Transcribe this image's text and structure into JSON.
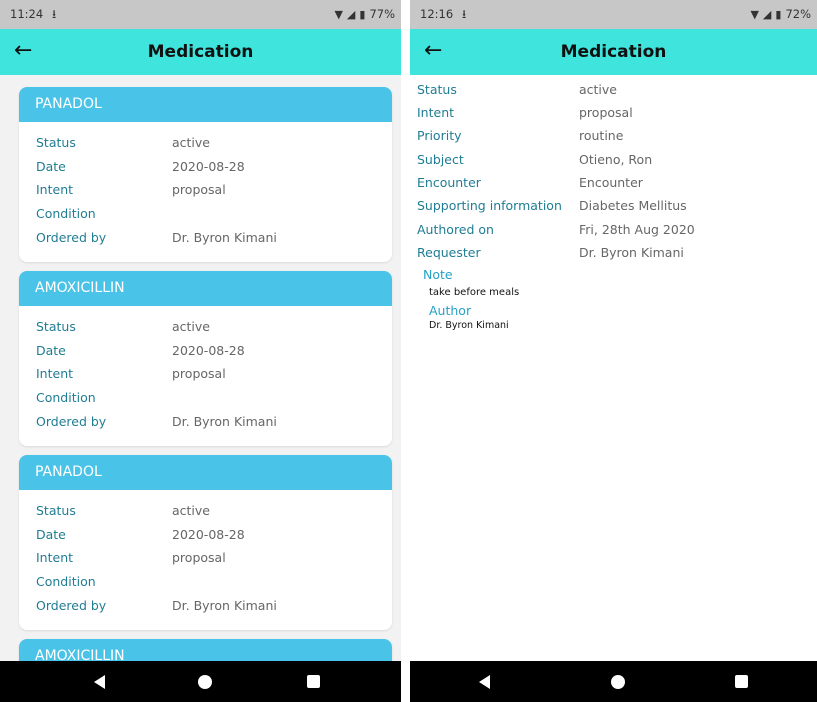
{
  "left_screen": {
    "status_bar": {
      "time": "11:24",
      "battery": "77%"
    },
    "app_bar": {
      "title": "Medication"
    },
    "labels": {
      "status": "Status",
      "date": "Date",
      "intent": "Intent",
      "condition": "Condition",
      "ordered_by": "Ordered by"
    },
    "cards": [
      {
        "name": "PANADOL",
        "status": "active",
        "date": "2020-08-28",
        "intent": "proposal",
        "condition": "",
        "ordered_by": "Dr. Byron Kimani"
      },
      {
        "name": "AMOXICILLIN",
        "status": "active",
        "date": "2020-08-28",
        "intent": "proposal",
        "condition": "",
        "ordered_by": "Dr. Byron Kimani"
      },
      {
        "name": "PANADOL",
        "status": "active",
        "date": "2020-08-28",
        "intent": "proposal",
        "condition": "",
        "ordered_by": "Dr. Byron Kimani"
      },
      {
        "name": "AMOXICILLIN"
      }
    ]
  },
  "right_screen": {
    "status_bar": {
      "time": "12:16",
      "battery": "72%"
    },
    "app_bar": {
      "title": "Medication"
    },
    "details": [
      {
        "label": "Status",
        "value": "active"
      },
      {
        "label": "Intent",
        "value": "proposal"
      },
      {
        "label": "Priority",
        "value": "routine"
      },
      {
        "label": "Subject",
        "value": "Otieno, Ron"
      },
      {
        "label": "Encounter",
        "value": "Encounter"
      },
      {
        "label": "Supporting information",
        "value": "Diabetes Mellitus"
      },
      {
        "label": "Authored on",
        "value": "Fri, 28th Aug 2020"
      },
      {
        "label": "Requester",
        "value": "Dr. Byron Kimani"
      }
    ],
    "note": {
      "label": "Note",
      "text": "take before meals",
      "author_label": "Author",
      "author": "Dr. Byron Kimani"
    }
  },
  "icons": {
    "back": "arrow-left-icon",
    "download": "download-icon",
    "wifi": "wifi-icon",
    "signal": "signal-icon",
    "battery": "battery-icon",
    "nav_back": "nav-back-icon",
    "nav_home": "nav-home-icon",
    "nav_recents": "nav-recents-icon"
  },
  "colors": {
    "app_bar": "#3fe5dc",
    "card_header": "#4ac3e8",
    "label": "#1f7d93",
    "note_label": "#26a0c8"
  }
}
